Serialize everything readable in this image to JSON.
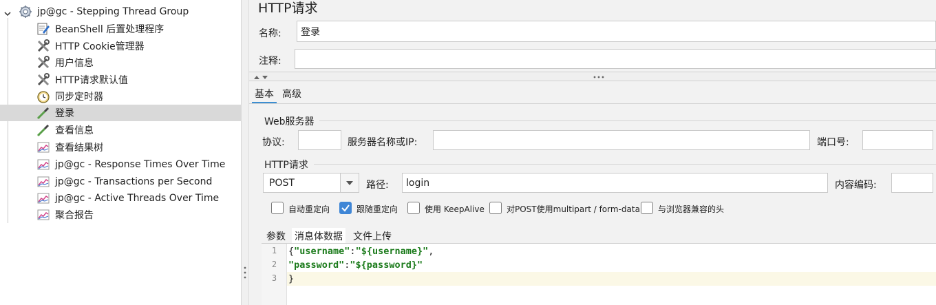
{
  "tree": {
    "root_label": "jp@gc - Stepping Thread Group",
    "items": [
      {
        "label": "BeanShell 后置处理程序",
        "icon": "script-edit-icon"
      },
      {
        "label": "HTTP Cookie管理器",
        "icon": "wrench-tools-icon"
      },
      {
        "label": "用户信息",
        "icon": "wrench-tools-icon"
      },
      {
        "label": "HTTP请求默认值",
        "icon": "wrench-tools-icon"
      },
      {
        "label": "同步定时器",
        "icon": "stopwatch-icon"
      },
      {
        "label": "登录",
        "icon": "pipette-sampler-icon",
        "selected": true
      },
      {
        "label": "查看信息",
        "icon": "pipette-sampler-icon"
      },
      {
        "label": "查看结果树",
        "icon": "graph-listener-icon"
      },
      {
        "label": "jp@gc - Response Times Over Time",
        "icon": "graph-listener-icon"
      },
      {
        "label": "jp@gc - Transactions per Second",
        "icon": "graph-listener-icon"
      },
      {
        "label": "jp@gc - Active Threads Over Time",
        "icon": "graph-listener-icon"
      },
      {
        "label": "聚合报告",
        "icon": "graph-listener-icon"
      }
    ]
  },
  "panel": {
    "title": "HTTP请求",
    "name_label": "名称:",
    "name_value": "登录",
    "comment_label": "注释:",
    "comment_value": "",
    "tabs": [
      "基本",
      "高级"
    ],
    "web_server": {
      "section_title": "Web服务器",
      "protocol_label": "协议:",
      "protocol_value": "",
      "server_label": "服务器名称或IP:",
      "server_value": "",
      "port_label": "端口号:",
      "port_value": ""
    },
    "http_request": {
      "section_title": "HTTP请求",
      "method_value": "POST",
      "path_label": "路径:",
      "path_value": "login",
      "encoding_label": "内容编码:",
      "encoding_value": ""
    },
    "checkboxes": [
      {
        "label": "自动重定向",
        "checked": false
      },
      {
        "label": "跟随重定向",
        "checked": true
      },
      {
        "label": "使用 KeepAlive",
        "checked": false
      },
      {
        "label": "对POST使用multipart / form-data",
        "checked": false
      },
      {
        "label": "与浏览器兼容的头",
        "checked": false
      }
    ],
    "body_tabs": [
      "参数",
      "消息体数据",
      "文件上传"
    ],
    "active_body_tab": "消息体数据",
    "code": {
      "line_numbers": [
        "1",
        "2",
        "3"
      ],
      "line1_open": "{",
      "line1_key": "\"username\"",
      "line1_colon": ":",
      "line1_value": "\"${username}\"",
      "line1_comma": ",",
      "line2_key": "\"password\"",
      "line2_colon": ":",
      "line2_value": "\"${password}\"",
      "line3": "}"
    }
  },
  "colors": {
    "accent": "#3c8ed1",
    "checkbox_checked": "#3f86d6",
    "selected_row": "#d9d9d9",
    "json_key": "#1a7a1a"
  }
}
